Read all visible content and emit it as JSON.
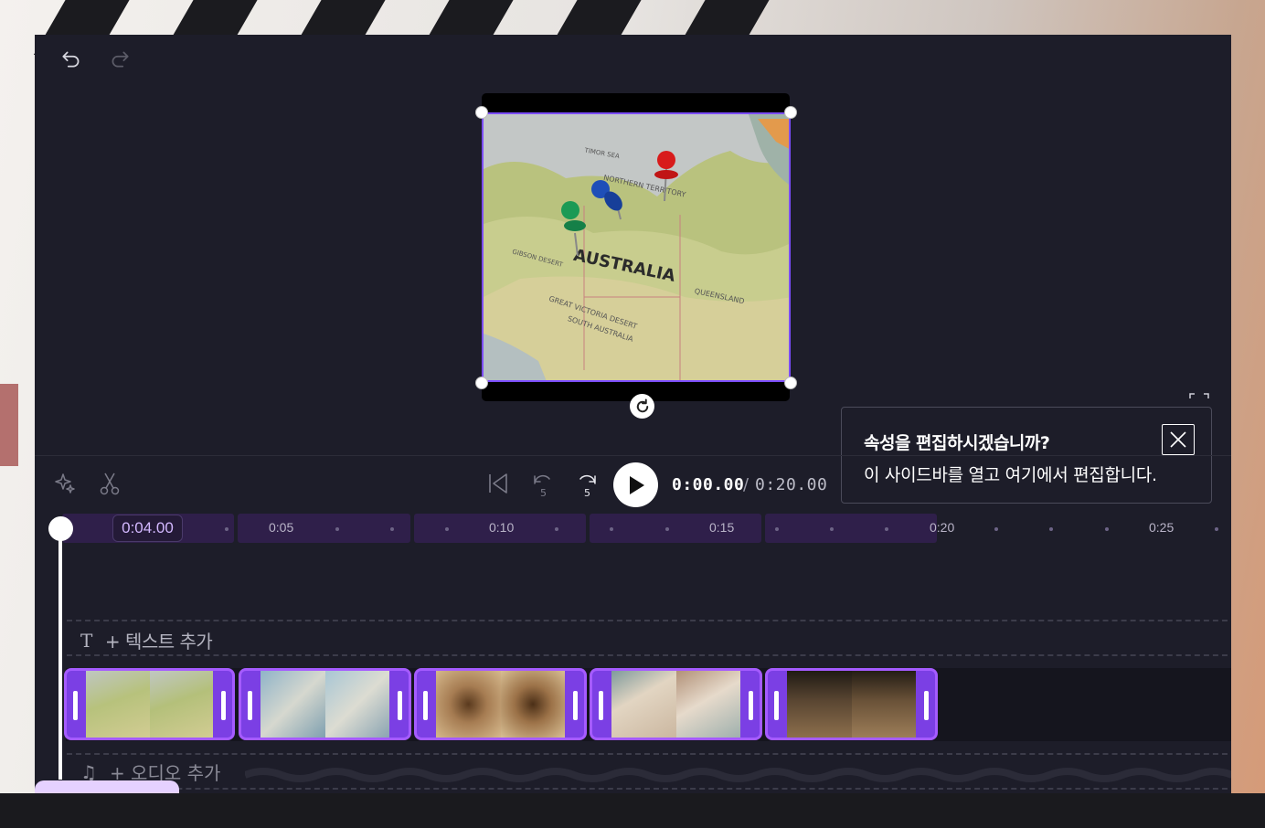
{
  "tooltip": {
    "title": "속성을 편집하시겠습니까?",
    "body": "이 사이드바를 열고 여기에서 편집합니다."
  },
  "preview": {
    "image_text": "AUSTRALIA",
    "image_labels": [
      "NORTHERN TERRITORY",
      "GREAT VICTORIA DESERT",
      "SOUTH AUSTRALIA",
      "QUEENSLAND",
      "TIMOR SEA",
      "GIBSON DESERT"
    ]
  },
  "playback": {
    "current_time": "0:00.00",
    "separator": "/",
    "total_time": "0:20.00",
    "skip_back_seconds": "5",
    "skip_forward_seconds": "5"
  },
  "ruler": {
    "current": "0:04.00",
    "labels": [
      "0:05",
      "0:10",
      "0:15",
      "0:20",
      "0:25"
    ]
  },
  "tracks": {
    "text_label": "+ 텍스트 추가",
    "audio_label": "+ 오디오 추가",
    "clip_count": 5
  },
  "colors": {
    "accent": "#7c4dff",
    "clip_border": "#a55bff",
    "panel": "#1d1d29"
  }
}
